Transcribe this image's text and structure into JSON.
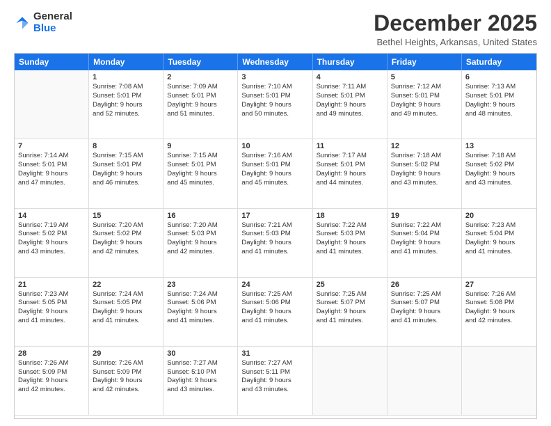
{
  "logo": {
    "general": "General",
    "blue": "Blue"
  },
  "header": {
    "month": "December 2025",
    "location": "Bethel Heights, Arkansas, United States"
  },
  "weekdays": [
    "Sunday",
    "Monday",
    "Tuesday",
    "Wednesday",
    "Thursday",
    "Friday",
    "Saturday"
  ],
  "weeks": [
    [
      {
        "day": "",
        "empty": true
      },
      {
        "day": "1",
        "lines": [
          "Sunrise: 7:08 AM",
          "Sunset: 5:01 PM",
          "Daylight: 9 hours",
          "and 52 minutes."
        ]
      },
      {
        "day": "2",
        "lines": [
          "Sunrise: 7:09 AM",
          "Sunset: 5:01 PM",
          "Daylight: 9 hours",
          "and 51 minutes."
        ]
      },
      {
        "day": "3",
        "lines": [
          "Sunrise: 7:10 AM",
          "Sunset: 5:01 PM",
          "Daylight: 9 hours",
          "and 50 minutes."
        ]
      },
      {
        "day": "4",
        "lines": [
          "Sunrise: 7:11 AM",
          "Sunset: 5:01 PM",
          "Daylight: 9 hours",
          "and 49 minutes."
        ]
      },
      {
        "day": "5",
        "lines": [
          "Sunrise: 7:12 AM",
          "Sunset: 5:01 PM",
          "Daylight: 9 hours",
          "and 49 minutes."
        ]
      },
      {
        "day": "6",
        "lines": [
          "Sunrise: 7:13 AM",
          "Sunset: 5:01 PM",
          "Daylight: 9 hours",
          "and 48 minutes."
        ]
      }
    ],
    [
      {
        "day": "7",
        "lines": [
          "Sunrise: 7:14 AM",
          "Sunset: 5:01 PM",
          "Daylight: 9 hours",
          "and 47 minutes."
        ]
      },
      {
        "day": "8",
        "lines": [
          "Sunrise: 7:15 AM",
          "Sunset: 5:01 PM",
          "Daylight: 9 hours",
          "and 46 minutes."
        ]
      },
      {
        "day": "9",
        "lines": [
          "Sunrise: 7:15 AM",
          "Sunset: 5:01 PM",
          "Daylight: 9 hours",
          "and 45 minutes."
        ]
      },
      {
        "day": "10",
        "lines": [
          "Sunrise: 7:16 AM",
          "Sunset: 5:01 PM",
          "Daylight: 9 hours",
          "and 45 minutes."
        ]
      },
      {
        "day": "11",
        "lines": [
          "Sunrise: 7:17 AM",
          "Sunset: 5:01 PM",
          "Daylight: 9 hours",
          "and 44 minutes."
        ]
      },
      {
        "day": "12",
        "lines": [
          "Sunrise: 7:18 AM",
          "Sunset: 5:02 PM",
          "Daylight: 9 hours",
          "and 43 minutes."
        ]
      },
      {
        "day": "13",
        "lines": [
          "Sunrise: 7:18 AM",
          "Sunset: 5:02 PM",
          "Daylight: 9 hours",
          "and 43 minutes."
        ]
      }
    ],
    [
      {
        "day": "14",
        "lines": [
          "Sunrise: 7:19 AM",
          "Sunset: 5:02 PM",
          "Daylight: 9 hours",
          "and 43 minutes."
        ]
      },
      {
        "day": "15",
        "lines": [
          "Sunrise: 7:20 AM",
          "Sunset: 5:02 PM",
          "Daylight: 9 hours",
          "and 42 minutes."
        ]
      },
      {
        "day": "16",
        "lines": [
          "Sunrise: 7:20 AM",
          "Sunset: 5:03 PM",
          "Daylight: 9 hours",
          "and 42 minutes."
        ]
      },
      {
        "day": "17",
        "lines": [
          "Sunrise: 7:21 AM",
          "Sunset: 5:03 PM",
          "Daylight: 9 hours",
          "and 41 minutes."
        ]
      },
      {
        "day": "18",
        "lines": [
          "Sunrise: 7:22 AM",
          "Sunset: 5:03 PM",
          "Daylight: 9 hours",
          "and 41 minutes."
        ]
      },
      {
        "day": "19",
        "lines": [
          "Sunrise: 7:22 AM",
          "Sunset: 5:04 PM",
          "Daylight: 9 hours",
          "and 41 minutes."
        ]
      },
      {
        "day": "20",
        "lines": [
          "Sunrise: 7:23 AM",
          "Sunset: 5:04 PM",
          "Daylight: 9 hours",
          "and 41 minutes."
        ]
      }
    ],
    [
      {
        "day": "21",
        "lines": [
          "Sunrise: 7:23 AM",
          "Sunset: 5:05 PM",
          "Daylight: 9 hours",
          "and 41 minutes."
        ]
      },
      {
        "day": "22",
        "lines": [
          "Sunrise: 7:24 AM",
          "Sunset: 5:05 PM",
          "Daylight: 9 hours",
          "and 41 minutes."
        ]
      },
      {
        "day": "23",
        "lines": [
          "Sunrise: 7:24 AM",
          "Sunset: 5:06 PM",
          "Daylight: 9 hours",
          "and 41 minutes."
        ]
      },
      {
        "day": "24",
        "lines": [
          "Sunrise: 7:25 AM",
          "Sunset: 5:06 PM",
          "Daylight: 9 hours",
          "and 41 minutes."
        ]
      },
      {
        "day": "25",
        "lines": [
          "Sunrise: 7:25 AM",
          "Sunset: 5:07 PM",
          "Daylight: 9 hours",
          "and 41 minutes."
        ]
      },
      {
        "day": "26",
        "lines": [
          "Sunrise: 7:25 AM",
          "Sunset: 5:07 PM",
          "Daylight: 9 hours",
          "and 41 minutes."
        ]
      },
      {
        "day": "27",
        "lines": [
          "Sunrise: 7:26 AM",
          "Sunset: 5:08 PM",
          "Daylight: 9 hours",
          "and 42 minutes."
        ]
      }
    ],
    [
      {
        "day": "28",
        "lines": [
          "Sunrise: 7:26 AM",
          "Sunset: 5:09 PM",
          "Daylight: 9 hours",
          "and 42 minutes."
        ]
      },
      {
        "day": "29",
        "lines": [
          "Sunrise: 7:26 AM",
          "Sunset: 5:09 PM",
          "Daylight: 9 hours",
          "and 42 minutes."
        ]
      },
      {
        "day": "30",
        "lines": [
          "Sunrise: 7:27 AM",
          "Sunset: 5:10 PM",
          "Daylight: 9 hours",
          "and 43 minutes."
        ]
      },
      {
        "day": "31",
        "lines": [
          "Sunrise: 7:27 AM",
          "Sunset: 5:11 PM",
          "Daylight: 9 hours",
          "and 43 minutes."
        ]
      },
      {
        "day": "",
        "empty": true
      },
      {
        "day": "",
        "empty": true
      },
      {
        "day": "",
        "empty": true
      }
    ]
  ]
}
